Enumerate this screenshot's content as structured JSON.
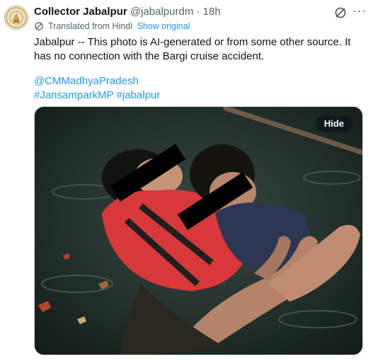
{
  "tweet": {
    "author_name": "Collector Jabalpur",
    "handle": "@jabalpurdm",
    "separator": "·",
    "time": "18h",
    "translated_label": "Translated from Hindi",
    "show_original": "Show original",
    "text": "Jabalpur -- This photo is AI-generated or from some other source. It has no connection with the Bargi cruise accident.",
    "links": [
      "@CMMadhyaPradesh",
      "#JansamparkMP",
      "#jabalpur"
    ],
    "more_label": "···"
  },
  "media": {
    "hide_label": "Hide"
  },
  "icons": {
    "grok": "grok-icon",
    "more": "more-icon",
    "translate": "translate-icon"
  },
  "colors": {
    "link": "#1d9bf0",
    "secondary": "#536471",
    "life_jacket": "#d9383a"
  }
}
